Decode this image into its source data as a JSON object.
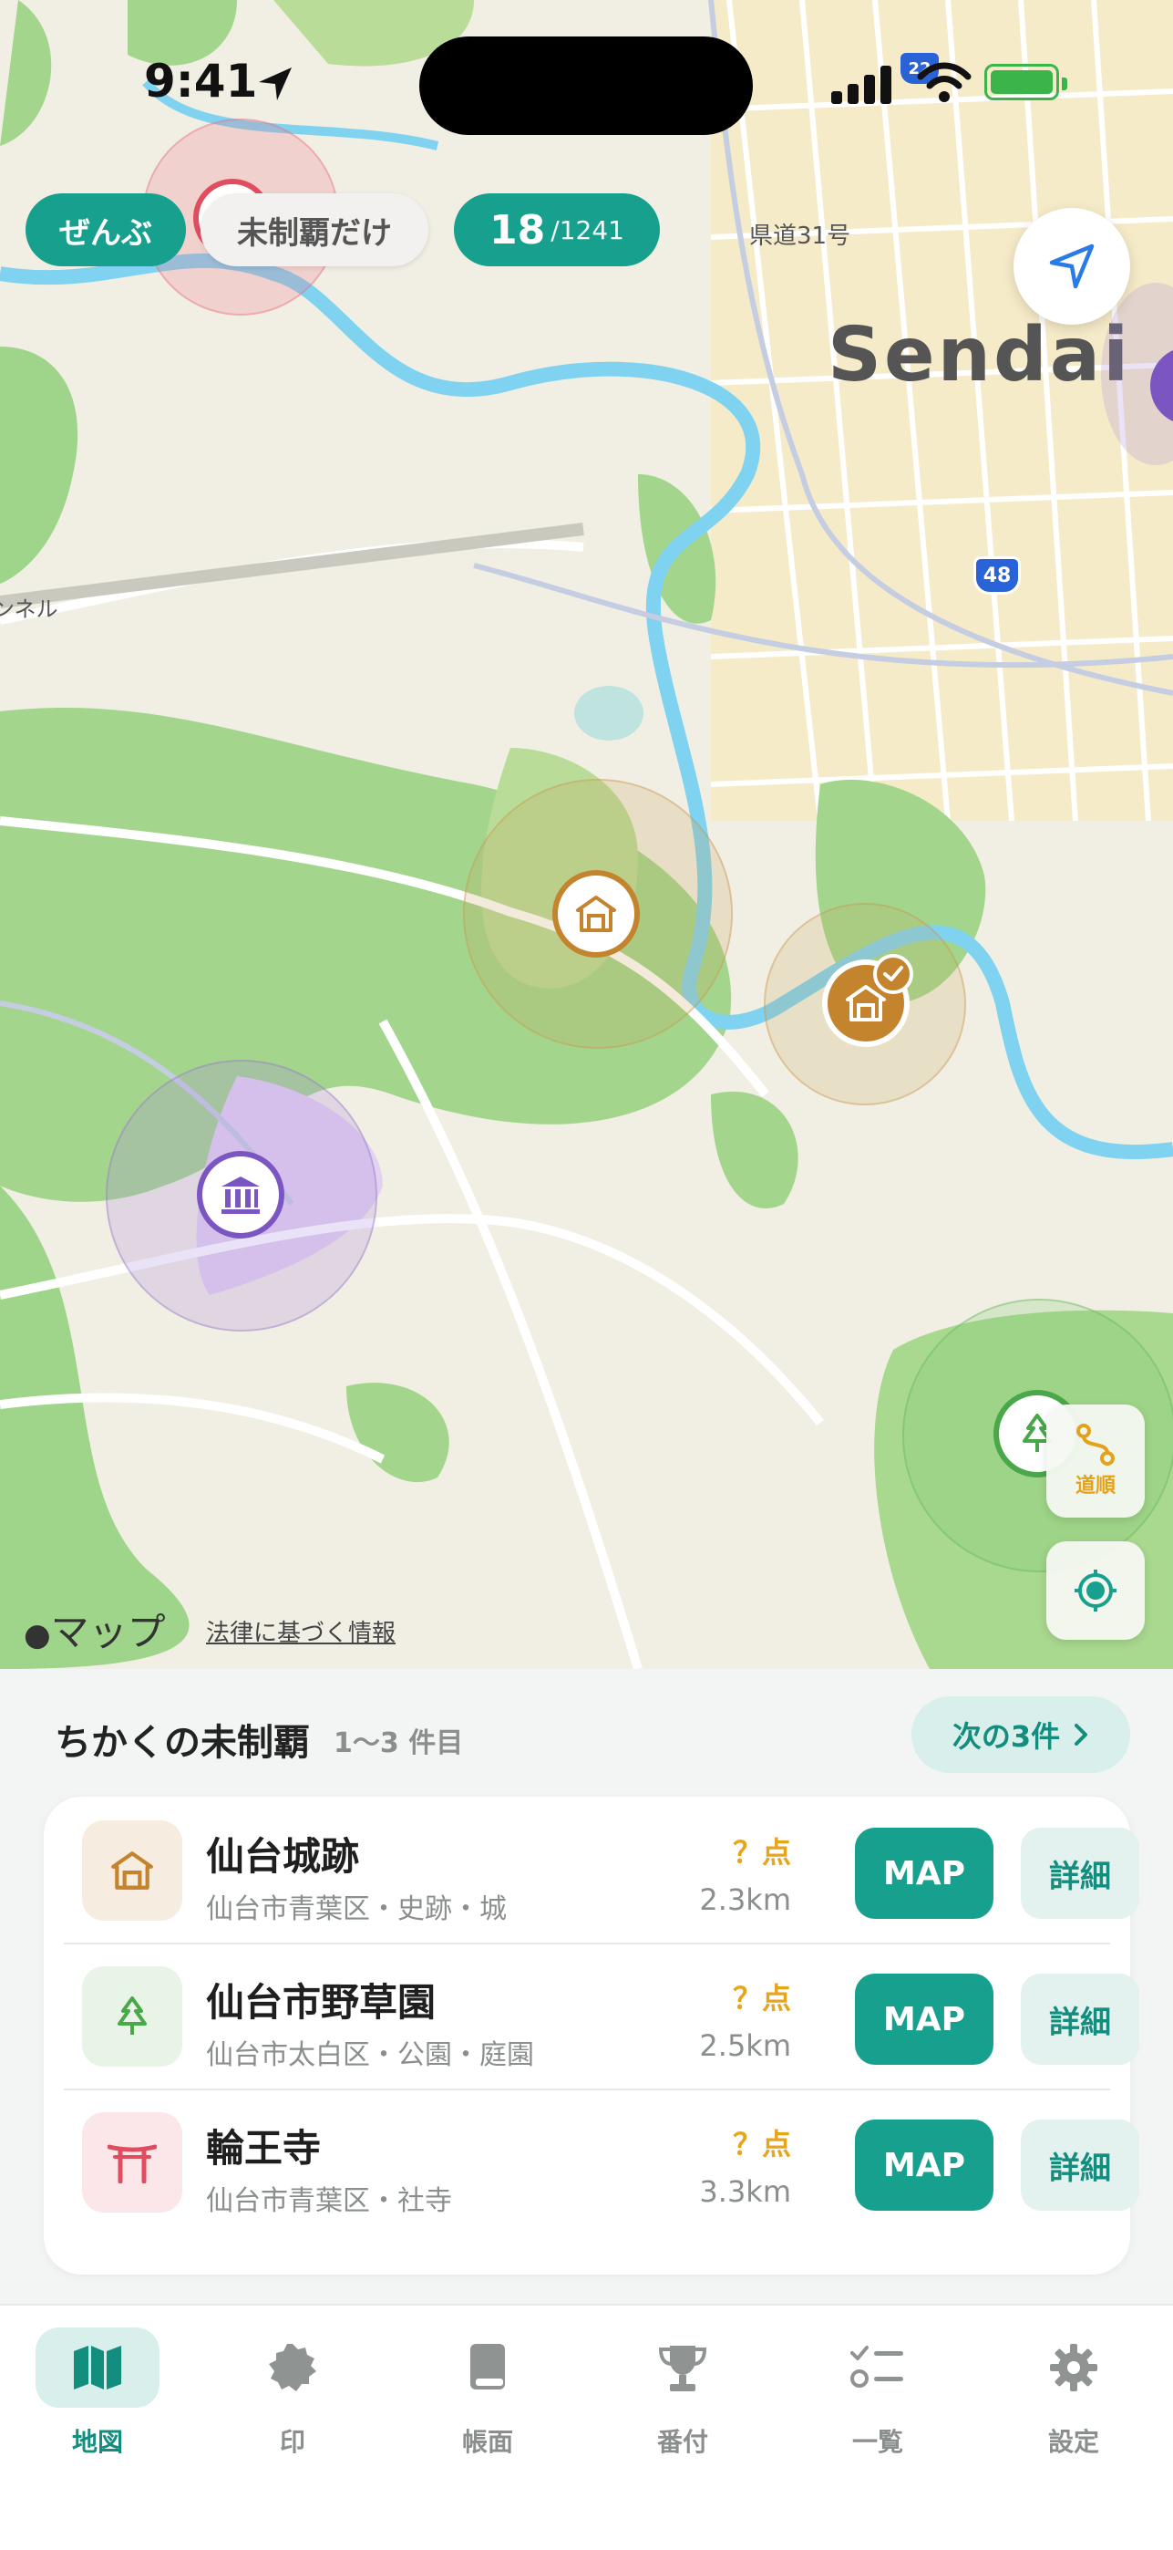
{
  "status_bar": {
    "time": "9:41",
    "route_badge": "22"
  },
  "map": {
    "city_label": "Sendai",
    "road_label": "県道31号",
    "tunnel_label": "ンネル",
    "route_shield": "48",
    "attribution": "マップ",
    "legal_link": "法律に基づく情報",
    "route_button_label": "道順"
  },
  "filters": {
    "all_label": "ぜんぶ",
    "unconquered_label": "未制覇だけ",
    "count_current": "18",
    "count_total": "/1241"
  },
  "sheet": {
    "title": "ちかくの未制覇",
    "range": "1〜3 件目",
    "next_label": "次の3件",
    "items": [
      {
        "name": "仙台城跡",
        "sub": "仙台市青葉区・史跡・城",
        "points": "？点",
        "distance": "2.3km",
        "map_label": "MAP",
        "detail_label": "詳細",
        "icon": "castle-icon",
        "tint": "#f7ece0",
        "icon_color": "#c4842e"
      },
      {
        "name": "仙台市野草園",
        "sub": "仙台市太白区・公園・庭園",
        "points": "？点",
        "distance": "2.5km",
        "map_label": "MAP",
        "detail_label": "詳細",
        "icon": "tree-icon",
        "tint": "#e7f4e6",
        "icon_color": "#4aa74a"
      },
      {
        "name": "輪王寺",
        "sub": "仙台市青葉区・社寺",
        "points": "？点",
        "distance": "3.3km",
        "map_label": "MAP",
        "detail_label": "詳細",
        "icon": "torii-icon",
        "tint": "#fbe6e9",
        "icon_color": "#e04d5f"
      }
    ]
  },
  "tabs": [
    {
      "label": "地図",
      "icon": "map-icon",
      "active": true
    },
    {
      "label": "印",
      "icon": "seal-icon",
      "active": false
    },
    {
      "label": "帳面",
      "icon": "book-icon",
      "active": false
    },
    {
      "label": "番付",
      "icon": "trophy-icon",
      "active": false
    },
    {
      "label": "一覧",
      "icon": "checklist-icon",
      "active": false
    },
    {
      "label": "設定",
      "icon": "gear-icon",
      "active": false
    }
  ],
  "colors": {
    "accent": "#17a08d",
    "points": "#e8a41a",
    "castle": "#c4842e",
    "museum": "#7b56c2",
    "park": "#4aa74a"
  }
}
